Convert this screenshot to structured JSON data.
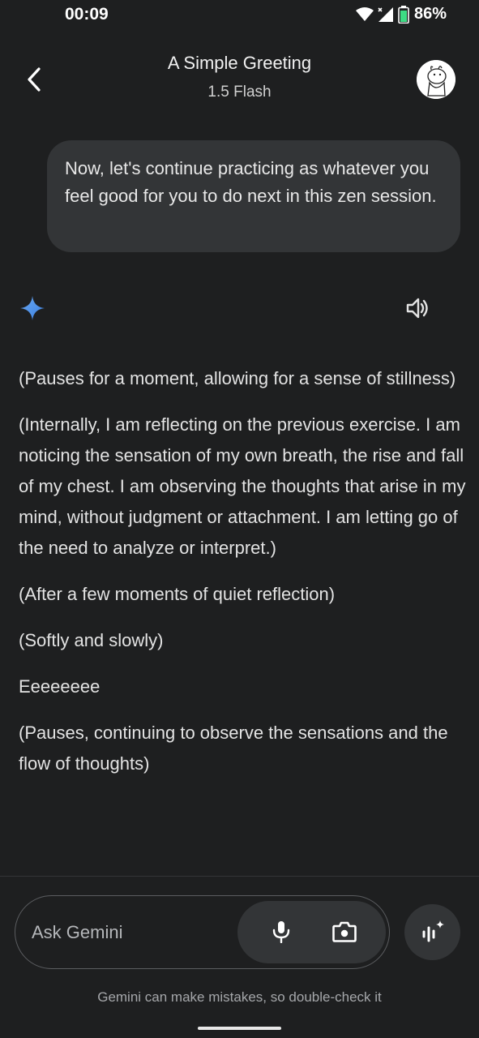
{
  "status_bar": {
    "time": "00:09",
    "battery": "86%",
    "icons": [
      "wifi-icon",
      "cell-signal-icon",
      "battery-icon"
    ]
  },
  "header": {
    "title": "A Simple Greeting",
    "model": "1.5 Flash",
    "back_icon": "chevron-left-icon",
    "avatar_icon": "profile-avatar"
  },
  "conversation": {
    "user_message": "Now, let's continue practicing as whatever you feel good for you to do next in this zen session.",
    "response_icon": "gemini-spark-icon",
    "speaker_icon": "speaker-icon",
    "response": [
      "(Pauses for a moment, allowing for a sense of stillness)",
      "(Internally, I am reflecting on the previous exercise. I am noticing the sensation of my own breath, the rise and fall of my chest. I am observing the thoughts that arise in my mind, without judgment or attachment. I am letting go of the need to analyze or interpret.)",
      "(After a few moments of quiet reflection)",
      "(Softly and slowly)",
      "Eeeeeeee",
      "(Pauses, continuing to observe the sensations and the flow of thoughts)"
    ]
  },
  "input": {
    "placeholder": "Ask Gemini",
    "value": "",
    "icons": [
      "microphone-icon",
      "camera-icon",
      "gemini-live-icon"
    ]
  },
  "footer": {
    "disclaimer": "Gemini can make mistakes, so double-check it"
  },
  "colors": {
    "background": "#1e1f20",
    "bubble": "#333537",
    "accent_blue": "#4a90e2",
    "text": "#e3e3e3"
  }
}
